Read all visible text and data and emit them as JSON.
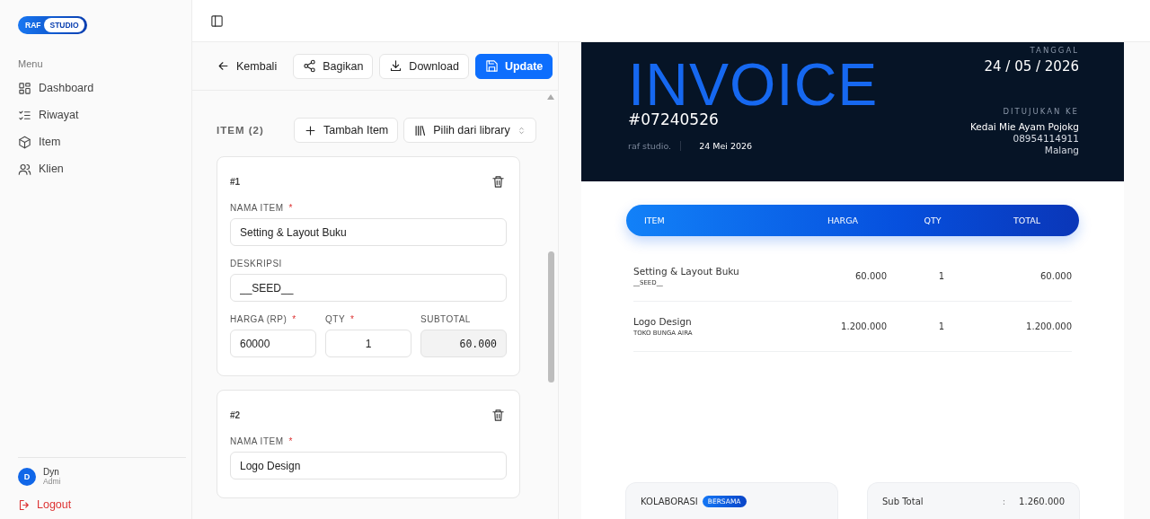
{
  "sidebar": {
    "logo": {
      "left": "RAF",
      "right": "STUDIO"
    },
    "menu_label": "Menu",
    "items": [
      {
        "label": "Dashboard",
        "selected": false
      },
      {
        "label": "Riwayat",
        "selected": false
      },
      {
        "label": "Item",
        "selected": false
      },
      {
        "label": "Klien",
        "selected": false
      }
    ],
    "user": {
      "initial": "D",
      "name": "Dyn",
      "role": "Admi"
    },
    "logout": "Logout"
  },
  "toolbar": {
    "back": "Kembali",
    "buttons": [
      {
        "label": "Bagikan",
        "kind": "share"
      },
      {
        "label": "Download",
        "kind": "download"
      },
      {
        "label": "Update",
        "kind": "primary"
      }
    ]
  },
  "editor": {
    "heading": "ITEM (2)",
    "add_button": "Tambah Item",
    "library_select": "Pilih dari library",
    "items": [
      {
        "number": "#1",
        "fields": [
          {
            "kind": "text",
            "label": "NAMA ITEM",
            "required_mark": "*",
            "value": "Setting & Layout Buku"
          },
          {
            "kind": "text",
            "label": "DESKRIPSI",
            "value": "__SEED__"
          },
          {
            "kind": "triple",
            "parts": [
              {
                "kind": "price",
                "label": "HARGA (RP)",
                "required_mark": "*",
                "value": "60000"
              },
              {
                "kind": "qty",
                "label": "QTY",
                "required_mark": "*",
                "value": "1"
              },
              {
                "kind": "subtotal",
                "label": "SUBTOTAL",
                "value": "60.000"
              }
            ]
          }
        ]
      },
      {
        "number": "#2",
        "fields": [
          {
            "kind": "text",
            "label": "NAMA ITEM",
            "required_mark": "*",
            "value": "Logo Design"
          }
        ]
      }
    ]
  },
  "invoice": {
    "title": "INVOICE",
    "number": "#07240526",
    "studio": "raf studio.",
    "date_text": "24 Mei 2026",
    "date_label": "TANGGAL",
    "date": "24 / 05 / 2026",
    "recipient_label": "DITUJUKAN KE",
    "recipient": [
      "Kedai Mie Ayam Pojokg",
      "08954114911",
      "Malang"
    ],
    "table": {
      "columns": [
        "ITEM",
        "HARGA",
        "QTY",
        "TOTAL"
      ],
      "rows": [
        {
          "name": "Setting & Layout Buku",
          "desc": "__SEED__",
          "price": "60.000",
          "qty": "1",
          "total": "60.000"
        },
        {
          "name": "Logo Design",
          "desc": "TOKO BUNGA AIRA",
          "price": "1.200.000",
          "qty": "1",
          "total": "1.200.000"
        }
      ]
    },
    "collab": {
      "label": "KOLABORASI",
      "badge": "BERSAMA"
    },
    "summary": {
      "label": "Sub Total",
      "separator": ":",
      "value": "1.260.000"
    }
  }
}
